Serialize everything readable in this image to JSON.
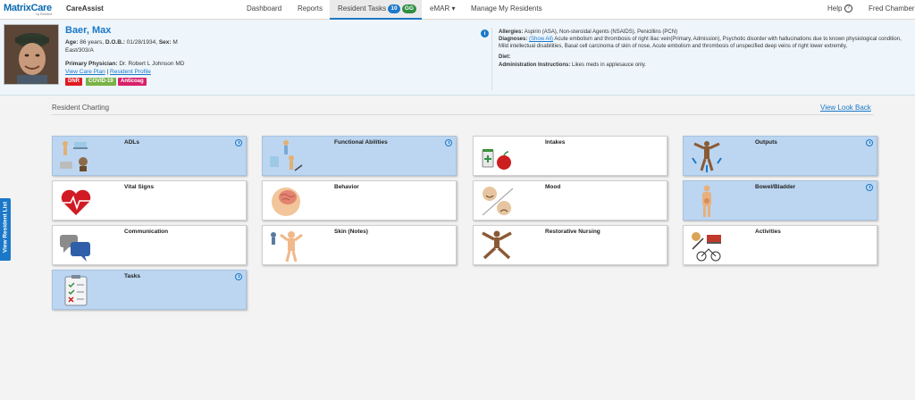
{
  "brand": {
    "logo": "MatrixCare",
    "logo_sub": "by ResMed",
    "product": "CareAssist"
  },
  "nav": {
    "dashboard": "Dashboard",
    "reports": "Reports",
    "resident_tasks": "Resident Tasks",
    "resident_tasks_count": "10",
    "resident_tasks_badge2": "GG",
    "emar": "eMAR ▾",
    "manage": "Manage My Residents",
    "help": "Help",
    "help_icon": "?",
    "user": "Fred Chamber"
  },
  "resident": {
    "name": "Baer, Max",
    "age_label": "Age:",
    "age": "86 years,",
    "dob_label": "D.O.B.:",
    "dob": "01/28/1934,",
    "sex_label": "Sex:",
    "sex": "M",
    "location": "East/303/A",
    "physician_label": "Primary Physician:",
    "physician": "Dr. Robert L Johnson MD",
    "care_plan": "View Care Plan",
    "sep": "|",
    "profile": "Resident Profile",
    "tags": [
      {
        "label": "DNR",
        "color": "#e01b22"
      },
      {
        "label": "COVID-19",
        "color": "#79b345"
      },
      {
        "label": "Anticoag",
        "color": "#d8206b"
      }
    ]
  },
  "clinical": {
    "info_icon": "i",
    "allergies_label": "Allergies:",
    "allergies": "Aspirin (ASA), Non-steroidal Agents (NSAIDS), Penicillins (PCN)",
    "diagnoses_label": "Diagnoses:",
    "show_all": "(Show All)",
    "diagnoses": "Acute embolism and thrombosis of right iliac vein(Primary, Admission), Psychotic disorder with hallucinations due to known physiological condition, Mild intellectual disabilities, Basal cell carcinoma of skin of nose, Acute embolism and thrombosis of unspecified deep veins of right lower extremity,",
    "diet_label": "Diet:",
    "diet": "",
    "admin_label": "Administration Instructions:",
    "admin": "Likes meds in applesauce only."
  },
  "charting": {
    "title": "Resident Charting",
    "look_back": "View Look Back",
    "tiles": [
      {
        "label": "ADLs",
        "highlight": true,
        "clock": true,
        "icon": "adls-icon"
      },
      {
        "label": "Functional Abilities",
        "highlight": true,
        "clock": true,
        "icon": "functional-abilities-icon"
      },
      {
        "label": "Intakes",
        "highlight": false,
        "clock": false,
        "icon": "intakes-icon"
      },
      {
        "label": "Outputs",
        "highlight": true,
        "clock": true,
        "icon": "outputs-icon"
      },
      {
        "label": "Vital Signs",
        "highlight": false,
        "clock": false,
        "icon": "heart-icon"
      },
      {
        "label": "Behavior",
        "highlight": false,
        "clock": false,
        "icon": "brain-icon"
      },
      {
        "label": "Mood",
        "highlight": false,
        "clock": false,
        "icon": "mood-faces-icon"
      },
      {
        "label": "Bowel/Bladder",
        "highlight": true,
        "clock": true,
        "icon": "bowel-bladder-icon"
      },
      {
        "label": "Communication",
        "highlight": false,
        "clock": false,
        "icon": "speech-bubbles-icon"
      },
      {
        "label": "Skin (Notes)",
        "highlight": false,
        "clock": false,
        "icon": "skin-figure-icon"
      },
      {
        "label": "Restorative Nursing",
        "highlight": false,
        "clock": false,
        "icon": "restorative-figure-icon"
      },
      {
        "label": "Activities",
        "highlight": false,
        "clock": false,
        "icon": "activities-icon"
      },
      {
        "label": "Tasks",
        "highlight": true,
        "clock": true,
        "icon": "clipboard-icon"
      }
    ]
  },
  "side_tab": "View Resident List",
  "colors": {
    "accent": "#1b78c8",
    "highlight_tile": "#bcd6f1",
    "dnr": "#e01b22",
    "covid": "#79b345",
    "anticoag": "#d8206b"
  }
}
